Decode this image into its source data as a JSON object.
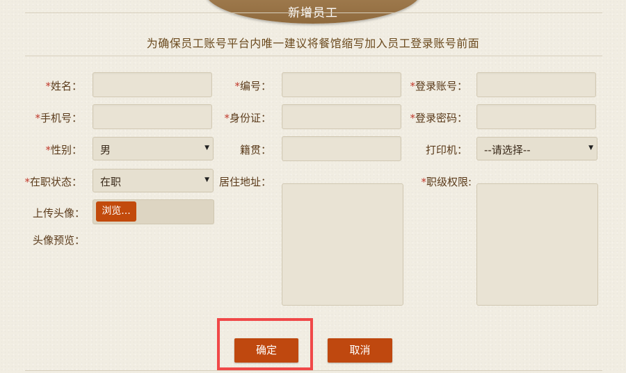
{
  "header": {
    "title": "新增员工"
  },
  "notice": "为确保员工账号平台内唯一建议将餐馆缩写加入员工登录账号前面",
  "labels": {
    "name": "姓名：",
    "employee_no": "编号：",
    "login_account": "登录账号：",
    "phone": "手机号：",
    "id_card": "身份证：",
    "login_password": "登录密码：",
    "gender": "性别：",
    "native_place": "籍贯：",
    "printer": "打印机：",
    "status": "在职状态：",
    "address": "居住地址：",
    "permissions": "职级权限:",
    "avatar_upload": "上传头像：",
    "avatar_preview": "头像预览："
  },
  "required_mark": "*",
  "fields": {
    "name": "",
    "employee_no": "",
    "login_account": "",
    "phone": "",
    "id_card": "",
    "login_password": "",
    "native_place": "",
    "address": "",
    "permissions": ""
  },
  "selects": {
    "gender": "男",
    "printer": "--请选择--",
    "status": "在职"
  },
  "upload": {
    "browse_label": "浏览..."
  },
  "buttons": {
    "confirm": "确定",
    "cancel": "取消"
  },
  "colors": {
    "accent_button": "#bf480f",
    "header_cap": "#a07d50",
    "highlight_border": "#f04848",
    "required": "#c0392b"
  }
}
